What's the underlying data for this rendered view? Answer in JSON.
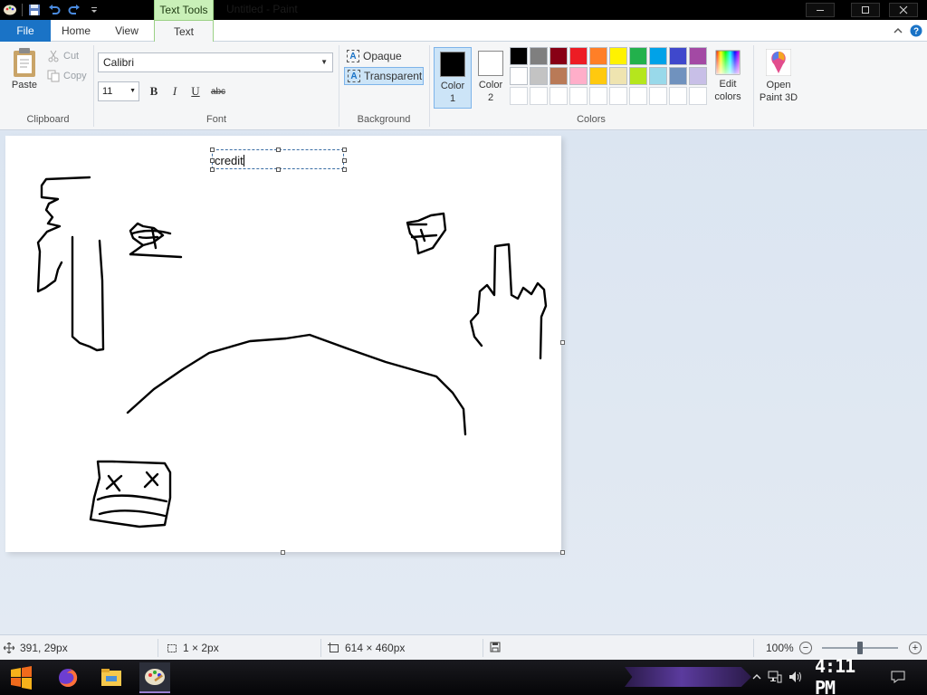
{
  "titlebar": {
    "title": "Untitled - Paint",
    "context_tab_label": "Text Tools",
    "controls": [
      "minimize",
      "maximize",
      "close"
    ]
  },
  "tabs": {
    "file": "File",
    "home": "Home",
    "view": "View",
    "text": "Text"
  },
  "clipboard": {
    "paste": "Paste",
    "cut": "Cut",
    "copy": "Copy",
    "label": "Clipboard"
  },
  "font": {
    "family": "Calibri",
    "size": "11",
    "bold": "B",
    "italic": "I",
    "underline": "U",
    "strikethrough": "abc",
    "label": "Font"
  },
  "background": {
    "opaque": "Opaque",
    "transparent": "Transparent",
    "selected": "Transparent",
    "label": "Background"
  },
  "colors": {
    "color1_label_a": "Color",
    "color1_label_b": "1",
    "color2_label_a": "Color",
    "color2_label_b": "2",
    "color1": "#000000",
    "color2": "#ffffff",
    "edit_label_a": "Edit",
    "edit_label_b": "colors",
    "paint3d_label_a": "Open",
    "paint3d_label_b": "Paint 3D",
    "label": "Colors",
    "palette_row1": [
      "#000000",
      "#7f7f7f",
      "#880015",
      "#ed1c24",
      "#ff7f27",
      "#fff200",
      "#22b14c",
      "#00a2e8",
      "#3f48cc",
      "#a349a4"
    ],
    "palette_row2": [
      "#ffffff",
      "#c3c3c3",
      "#b97a57",
      "#ffaec9",
      "#ffc90e",
      "#efe4b0",
      "#b5e61d",
      "#99d9ea",
      "#7092be",
      "#c8bfe7"
    ],
    "palette_row3": [
      "#ffffff",
      "#ffffff",
      "#ffffff",
      "#ffffff",
      "#ffffff",
      "#ffffff",
      "#ffffff",
      "#ffffff",
      "#ffffff",
      "#ffffff"
    ]
  },
  "canvas": {
    "text_content": "credit"
  },
  "statusbar": {
    "cursor_pos": "391, 29px",
    "selection_size": "1 × 2px",
    "image_size": "614 × 460px",
    "zoom": "100%",
    "zoom_level": 0.5
  },
  "taskbar": {
    "clock": "4:11 PM"
  }
}
